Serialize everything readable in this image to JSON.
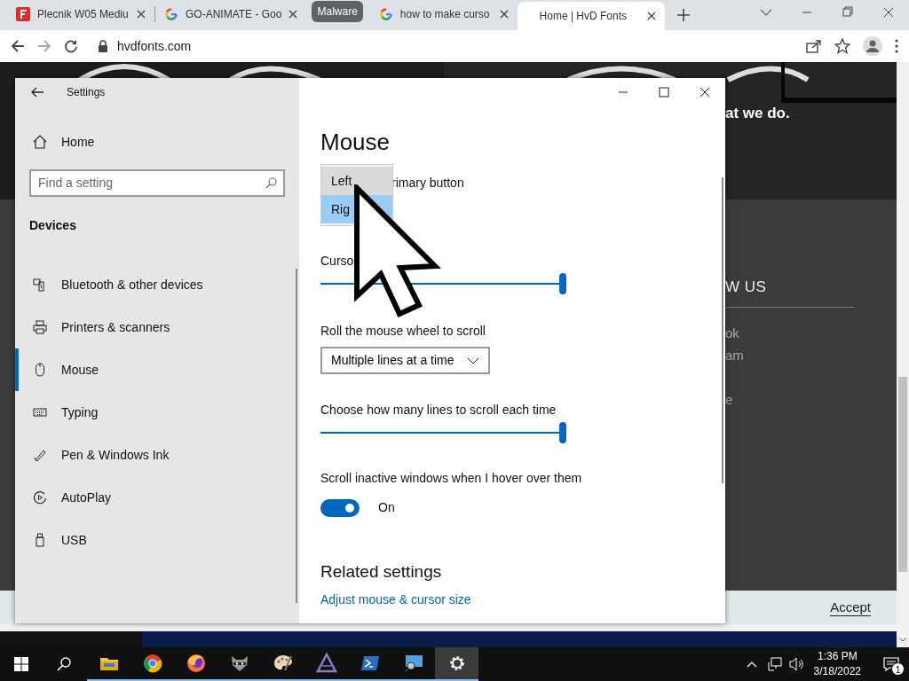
{
  "browser": {
    "tabs": [
      {
        "kind": "letter-f",
        "title": "Plecnik W05 Mediu",
        "selected": false
      },
      {
        "kind": "google",
        "title": "GO-ANIMATE - Goo",
        "selected": false
      },
      {
        "kind": "group",
        "title": "Malware"
      },
      {
        "kind": "google",
        "title": "how to make curso",
        "selected": false
      },
      {
        "kind": "plain",
        "title": "Home | HvD Fonts",
        "selected": true
      }
    ],
    "address": "hvdfonts.com"
  },
  "website": {
    "tagline": "at we do.",
    "follow_heading": "W US",
    "links": [
      "ok",
      "am",
      "e"
    ],
    "cookie_button": "Accept"
  },
  "settings": {
    "title": "Settings",
    "home": "Home",
    "search": {
      "placeholder": "Find a setting"
    },
    "section": "Devices",
    "nav": [
      {
        "label": "Bluetooth & other devices",
        "kind": "bluetooth",
        "selected": false
      },
      {
        "label": "Printers & scanners",
        "kind": "printer",
        "selected": false
      },
      {
        "label": "Mouse",
        "kind": "mouse",
        "selected": true
      },
      {
        "label": "Typing",
        "kind": "keyboard",
        "selected": false
      },
      {
        "label": "Pen & Windows Ink",
        "kind": "pen",
        "selected": false
      },
      {
        "label": "AutoPlay",
        "kind": "autoplay",
        "selected": false
      },
      {
        "label": "USB",
        "kind": "usb",
        "selected": false
      }
    ],
    "page_title": "Mouse",
    "primary_button": {
      "label": "rimary button",
      "options": [
        {
          "label": "Left",
          "selected": false
        },
        {
          "label": "Rig",
          "selected": true
        }
      ]
    },
    "cursor_speed": {
      "label": "Curso",
      "level": 1
    },
    "wheel": {
      "label": "Roll the mouse wheel to scroll",
      "value": "Multiple lines at a time"
    },
    "lines": {
      "label": "Choose how many lines to scroll each time",
      "level": 1
    },
    "inactive": {
      "label": "Scroll inactive windows when I hover over them",
      "on": true,
      "state_label": "On"
    },
    "related": {
      "heading": "Related settings",
      "link": "Adjust mouse & cursor size"
    }
  },
  "taskbar": {
    "apps": [
      {
        "kind": "explorer",
        "active": false
      },
      {
        "kind": "chrome",
        "active": false
      },
      {
        "kind": "firefox",
        "active": false
      },
      {
        "kind": "raccoon",
        "active": false
      },
      {
        "kind": "paint",
        "active": false
      },
      {
        "kind": "letter-a",
        "active": false
      },
      {
        "kind": "powershell",
        "active": false
      },
      {
        "kind": "monitor",
        "active": false
      },
      {
        "kind": "settings",
        "active": true
      }
    ],
    "time": "1:36 PM",
    "date": "3/18/2022",
    "notifications": "1"
  }
}
